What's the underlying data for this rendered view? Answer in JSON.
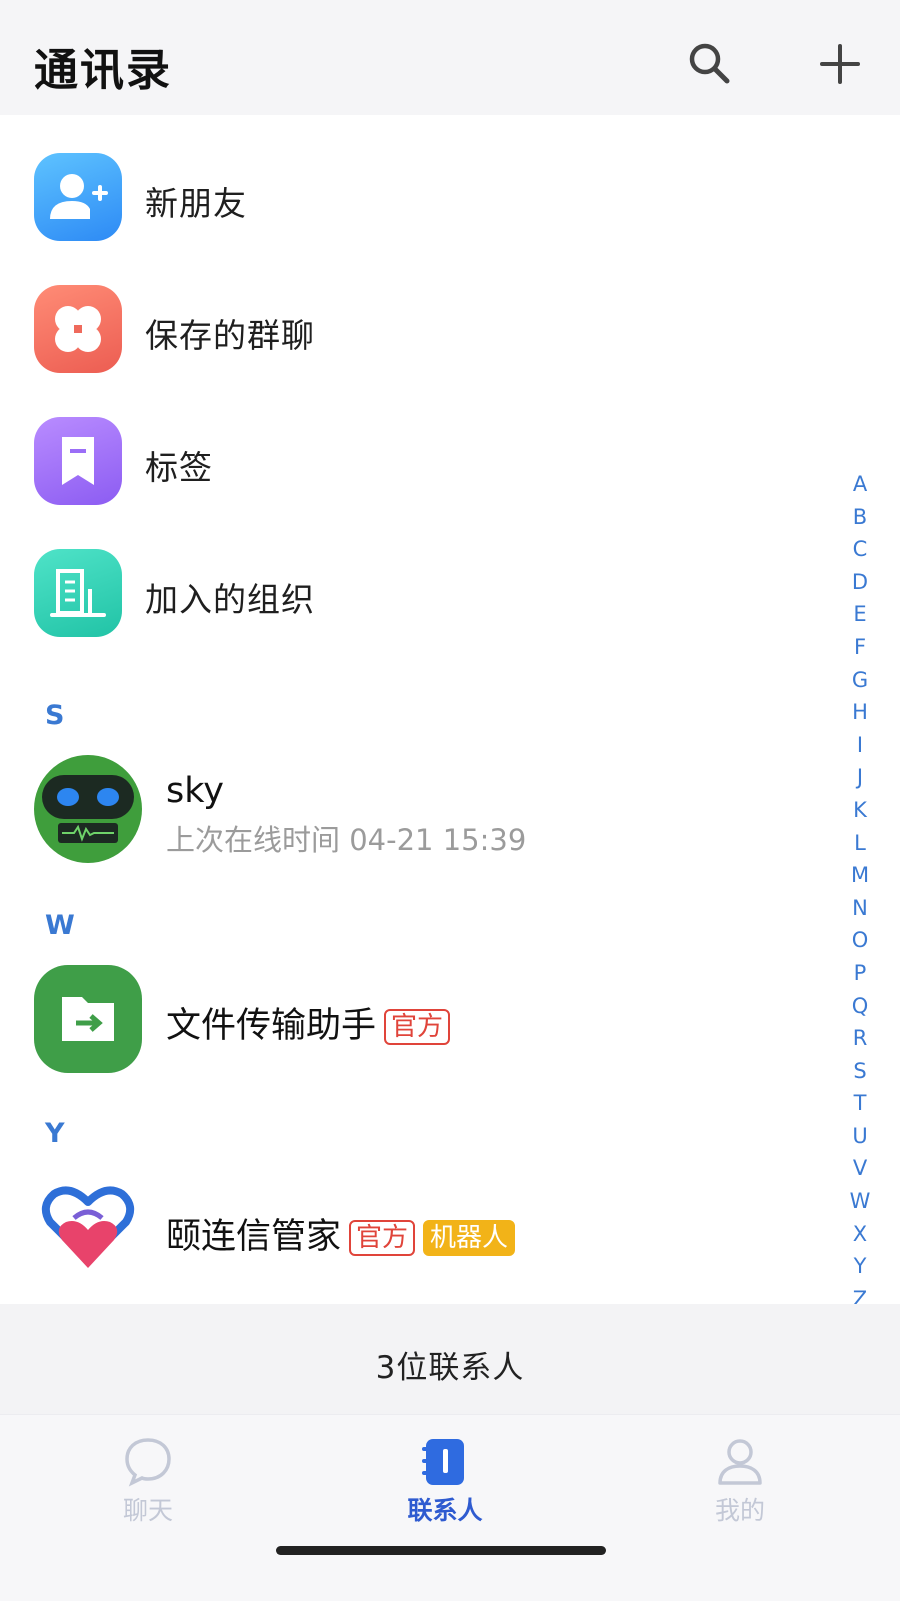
{
  "header": {
    "title": "通讯录",
    "search_icon": "search-icon",
    "add_icon": "plus-icon"
  },
  "features": [
    {
      "label": "新朋友",
      "icon": "add-person-icon",
      "color": "#3aa6fb"
    },
    {
      "label": "保存的群聊",
      "icon": "group-chat-icon",
      "color": "#f26f60"
    },
    {
      "label": "标签",
      "icon": "bookmark-tag-icon",
      "color": "#a276fb"
    },
    {
      "label": "加入的组织",
      "icon": "building-icon",
      "color": "#2fd0b2"
    }
  ],
  "sections": [
    {
      "letter": "S",
      "contacts": [
        {
          "name": "sky",
          "status": "上次在线时间 04-21 15:39",
          "avatar": "robot-avatar"
        }
      ]
    },
    {
      "letter": "W",
      "contacts": [
        {
          "name": "文件传输助手",
          "badges": [
            "官方"
          ],
          "avatar": "file-transfer-avatar"
        }
      ]
    },
    {
      "letter": "Y",
      "contacts": [
        {
          "name": "颐连信管家",
          "badges": [
            "官方",
            "机器人"
          ],
          "avatar": "heart-logo-avatar"
        }
      ]
    }
  ],
  "alphabet_index": [
    "A",
    "B",
    "C",
    "D",
    "E",
    "F",
    "G",
    "H",
    "I",
    "J",
    "K",
    "L",
    "M",
    "N",
    "O",
    "P",
    "Q",
    "R",
    "S",
    "T",
    "U",
    "V",
    "W",
    "X",
    "Y",
    "Z",
    "#"
  ],
  "contact_count": "3位联系人",
  "tabbar": {
    "tabs": [
      {
        "label": "聊天",
        "icon": "chat-bubble-icon",
        "active": false
      },
      {
        "label": "联系人",
        "icon": "contacts-book-icon",
        "active": true
      },
      {
        "label": "我的",
        "icon": "profile-icon",
        "active": false
      }
    ]
  },
  "colors": {
    "accent": "#3a79d2",
    "active_tab": "#2f5bd0",
    "official_badge": "#e0443a",
    "bot_badge": "#f2b318"
  }
}
